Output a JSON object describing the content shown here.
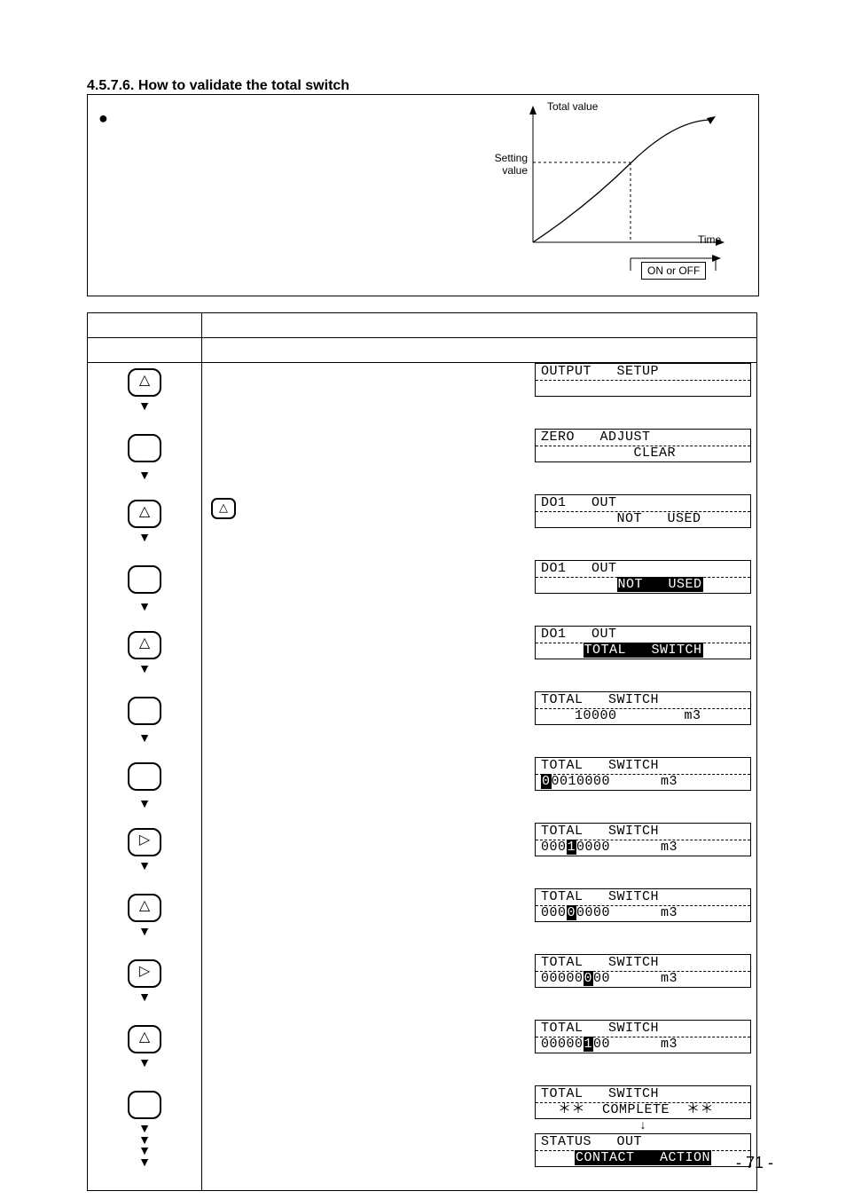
{
  "heading": "4.5.7.6. How to validate the total switch",
  "chart_data": {
    "type": "line",
    "title": "",
    "xlabel": "Time",
    "ylabel": "Total value",
    "x": [
      0,
      0.6,
      1.0
    ],
    "y": [
      0,
      0.38,
      0.88
    ],
    "annotations": {
      "setting_value_label": "Setting\nvalue",
      "threshold_x": 0.6,
      "output_label": "ON or OFF"
    }
  },
  "labels": {
    "total_value": "Total value",
    "setting_value": "Setting\nvalue",
    "time": "Time",
    "on_off": "ON or OFF",
    "page_num": "- 71 -"
  },
  "keys": {
    "up": "△",
    "right": "▷",
    "down_arrow": "▼"
  },
  "lcds": [
    {
      "l1": "OUTPUT   SETUP",
      "l2": " "
    },
    {
      "l1": "ZERO   ADJUST",
      "l2": "           CLEAR"
    },
    {
      "l1": "DO1   OUT",
      "l2": "         NOT   USED"
    },
    {
      "l1": "DO1   OUT",
      "l2_pre": "         ",
      "l2_inv": "NOT   USED"
    },
    {
      "l1": "DO1   OUT",
      "l2_pre": "     ",
      "l2_inv": "TOTAL   SWITCH"
    },
    {
      "l1": "TOTAL   SWITCH",
      "l2": "    10000        m3"
    },
    {
      "l1": "TOTAL   SWITCH",
      "l2_pre": "",
      "l2_inv": "0",
      "l2_post": "0010000      m3"
    },
    {
      "l1": "TOTAL   SWITCH",
      "l2_pre": "000",
      "l2_inv": "1",
      "l2_post": "0000      m3"
    },
    {
      "l1": "TOTAL   SWITCH",
      "l2_pre": "000",
      "l2_inv": "0",
      "l2_post": "0000      m3"
    },
    {
      "l1": "TOTAL   SWITCH",
      "l2_pre": "00000",
      "l2_inv": "0",
      "l2_post": "00      m3"
    },
    {
      "l1": "TOTAL   SWITCH",
      "l2_pre": "00000",
      "l2_inv": "1",
      "l2_post": "00      m3"
    },
    {
      "l1": "TOTAL   SWITCH",
      "l2": "  ＊＊  COMPLETE  ＊＊"
    },
    {
      "arrow": "↓"
    },
    {
      "l1": "STATUS   OUT",
      "l2_pre": "    ",
      "l2_inv": "CONTACT   ACTION"
    }
  ]
}
